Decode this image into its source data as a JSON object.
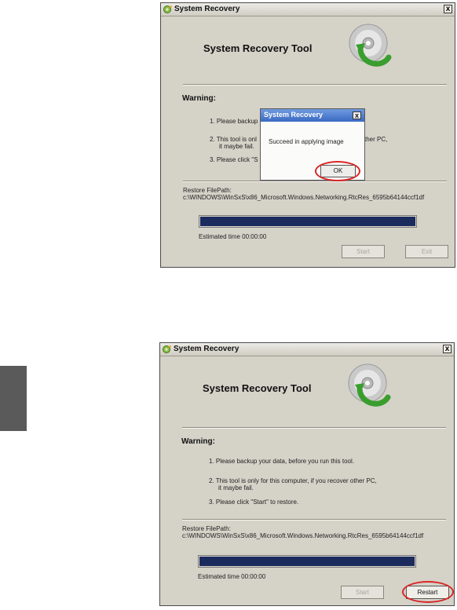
{
  "colors": {
    "annotation_circle": "#d92626",
    "progress_fill": "#1c2b5e",
    "dialog_title": "#3a69c2"
  },
  "screens": [
    {
      "window_title": "System Recovery",
      "close_glyph": "x",
      "heading": "System Recovery Tool",
      "warning_label": "Warning:",
      "steps": [
        "1. Please backup",
        "2. This tool is onl",
        "it maybe fail.",
        "3. Please click \"S"
      ],
      "steps_right_fragment": "ther PC,",
      "restore_path_label": "Restore FilePath:",
      "restore_path": "c:\\WINDOWS\\WinSxS\\x86_Microsoft.Windows.Networking.RtcRes_6595b64144ccf1df",
      "progress_value": 1.0,
      "estimated_time": "Estimated time 00:00:00",
      "buttons": {
        "start": "Start",
        "exit": "Exit"
      },
      "dialog": {
        "title": "System Recovery",
        "close_glyph": "x",
        "message": "Succeed in applying image",
        "ok_button": "OK"
      }
    },
    {
      "window_title": "System Recovery",
      "close_glyph": "x",
      "heading": "System Recovery Tool",
      "warning_label": "Warning:",
      "steps": [
        "1. Please backup your data, before you run this tool.",
        "2. This tool is only for this computer, if you recover other PC,",
        "it maybe fail.",
        "3. Please click \"Start\" to restore."
      ],
      "restore_path_label": "Restore FilePath:",
      "restore_path": "c:\\WINDOWS\\WinSxS\\x86_Microsoft.Windows.Networking.RtcRes_6595b64144ccf1df",
      "progress_value": 1.0,
      "estimated_time": "Estimated time 00:00:00",
      "buttons": {
        "start": "Start",
        "restart": "Restart"
      }
    }
  ]
}
